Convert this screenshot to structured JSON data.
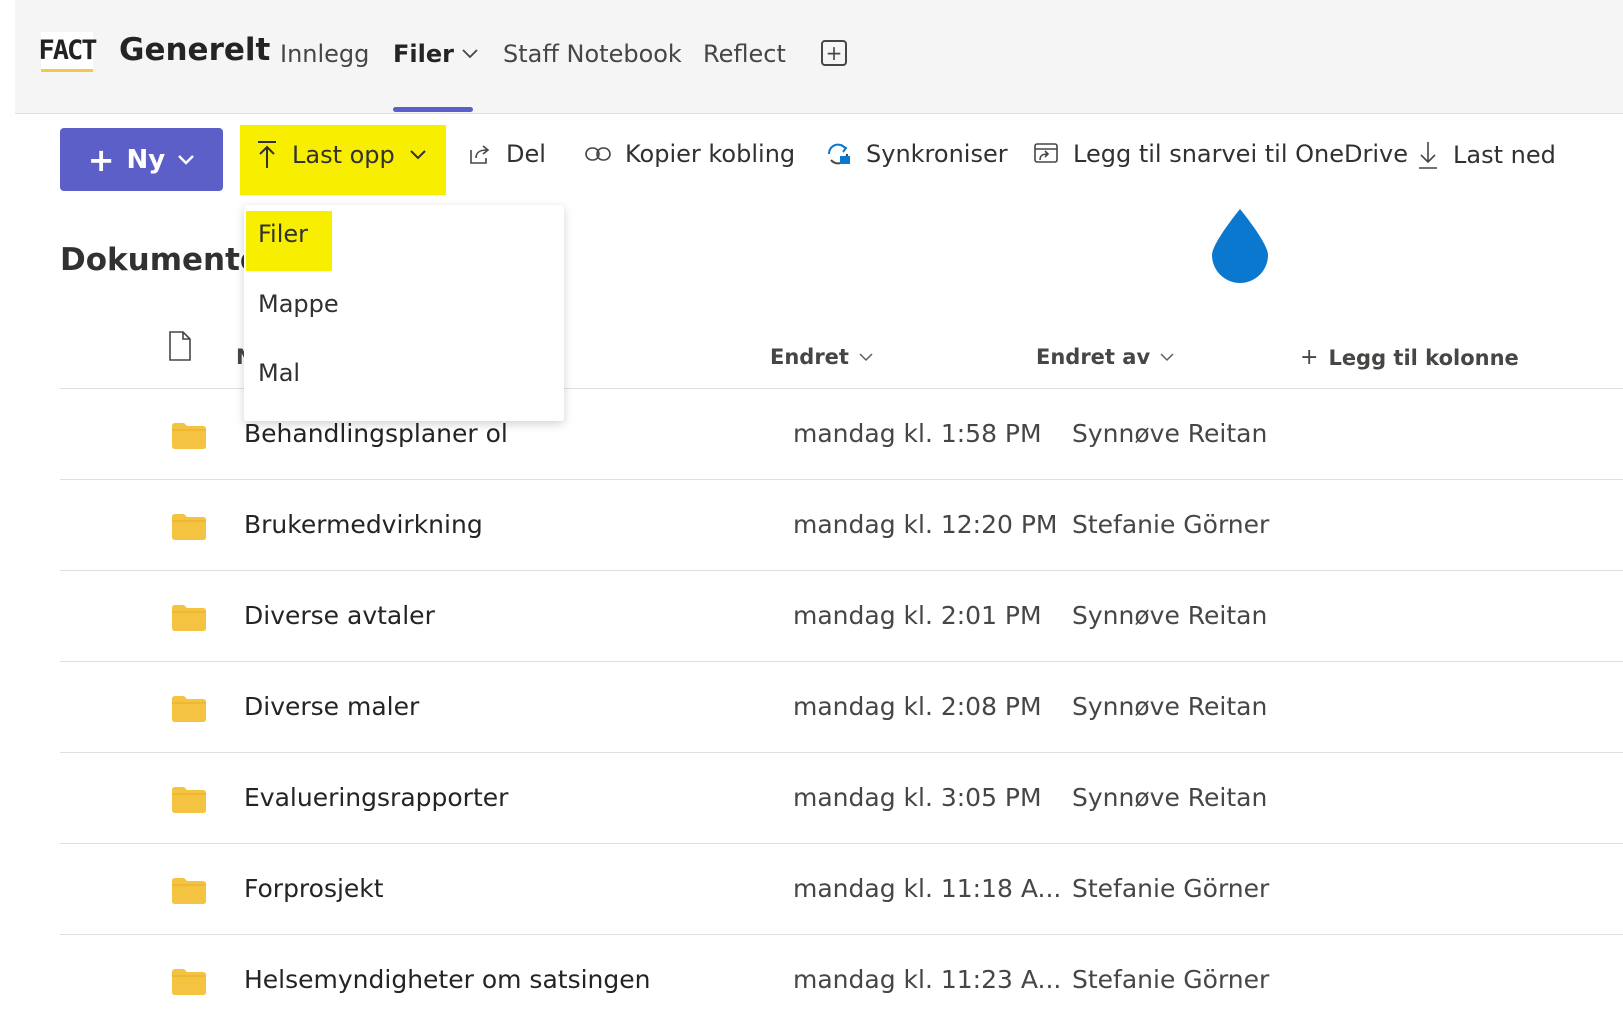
{
  "header": {
    "logo_text": "FACT",
    "team_name": "Generelt",
    "tabs": [
      {
        "label": "Innlegg"
      },
      {
        "label": "Filer"
      },
      {
        "label": "Staff Notebook"
      },
      {
        "label": "Reflect"
      }
    ],
    "add_tab_symbol": "+"
  },
  "toolbar": {
    "new_label": "Ny",
    "upload_label": "Last opp",
    "share_label": "Del",
    "copy_link_label": "Kopier kobling",
    "sync_label": "Synkroniser",
    "add_shortcut_label": "Legg til snarvei til OneDrive",
    "download_label": "Last ned"
  },
  "upload_menu": {
    "items": [
      {
        "label": "Filer"
      },
      {
        "label": "Mappe"
      },
      {
        "label": "Mal"
      }
    ]
  },
  "section_title": "Dokumenter",
  "table": {
    "columns": {
      "name_partial": "N",
      "modified": "Endret",
      "modified_by": "Endret av",
      "add_column": "Legg til kolonne"
    },
    "rows": [
      {
        "name": "Behandlingsplaner ol",
        "modified": "mandag kl. 1:58 PM",
        "modified_by": "Synnøve Reitan"
      },
      {
        "name": "Brukermedvirkning",
        "modified": "mandag kl. 12:20 PM",
        "modified_by": "Stefanie Görner"
      },
      {
        "name": "Diverse avtaler",
        "modified": "mandag kl. 2:01 PM",
        "modified_by": "Synnøve Reitan"
      },
      {
        "name": "Diverse maler",
        "modified": "mandag kl. 2:08 PM",
        "modified_by": "Synnøve Reitan"
      },
      {
        "name": "Evalueringsrapporter",
        "modified": "mandag kl. 3:05 PM",
        "modified_by": "Synnøve Reitan"
      },
      {
        "name": "Forprosjekt",
        "modified": "mandag kl. 11:18 A...",
        "modified_by": "Stefanie Görner"
      },
      {
        "name": "Helsemyndigheter om satsingen",
        "modified": "mandag kl. 11:23 A...",
        "modified_by": "Stefanie Görner"
      }
    ]
  },
  "colors": {
    "accent": "#5b5fc7",
    "highlight": "#f7ee00",
    "folder": "#f5c342",
    "drop": "#0b78d0"
  }
}
